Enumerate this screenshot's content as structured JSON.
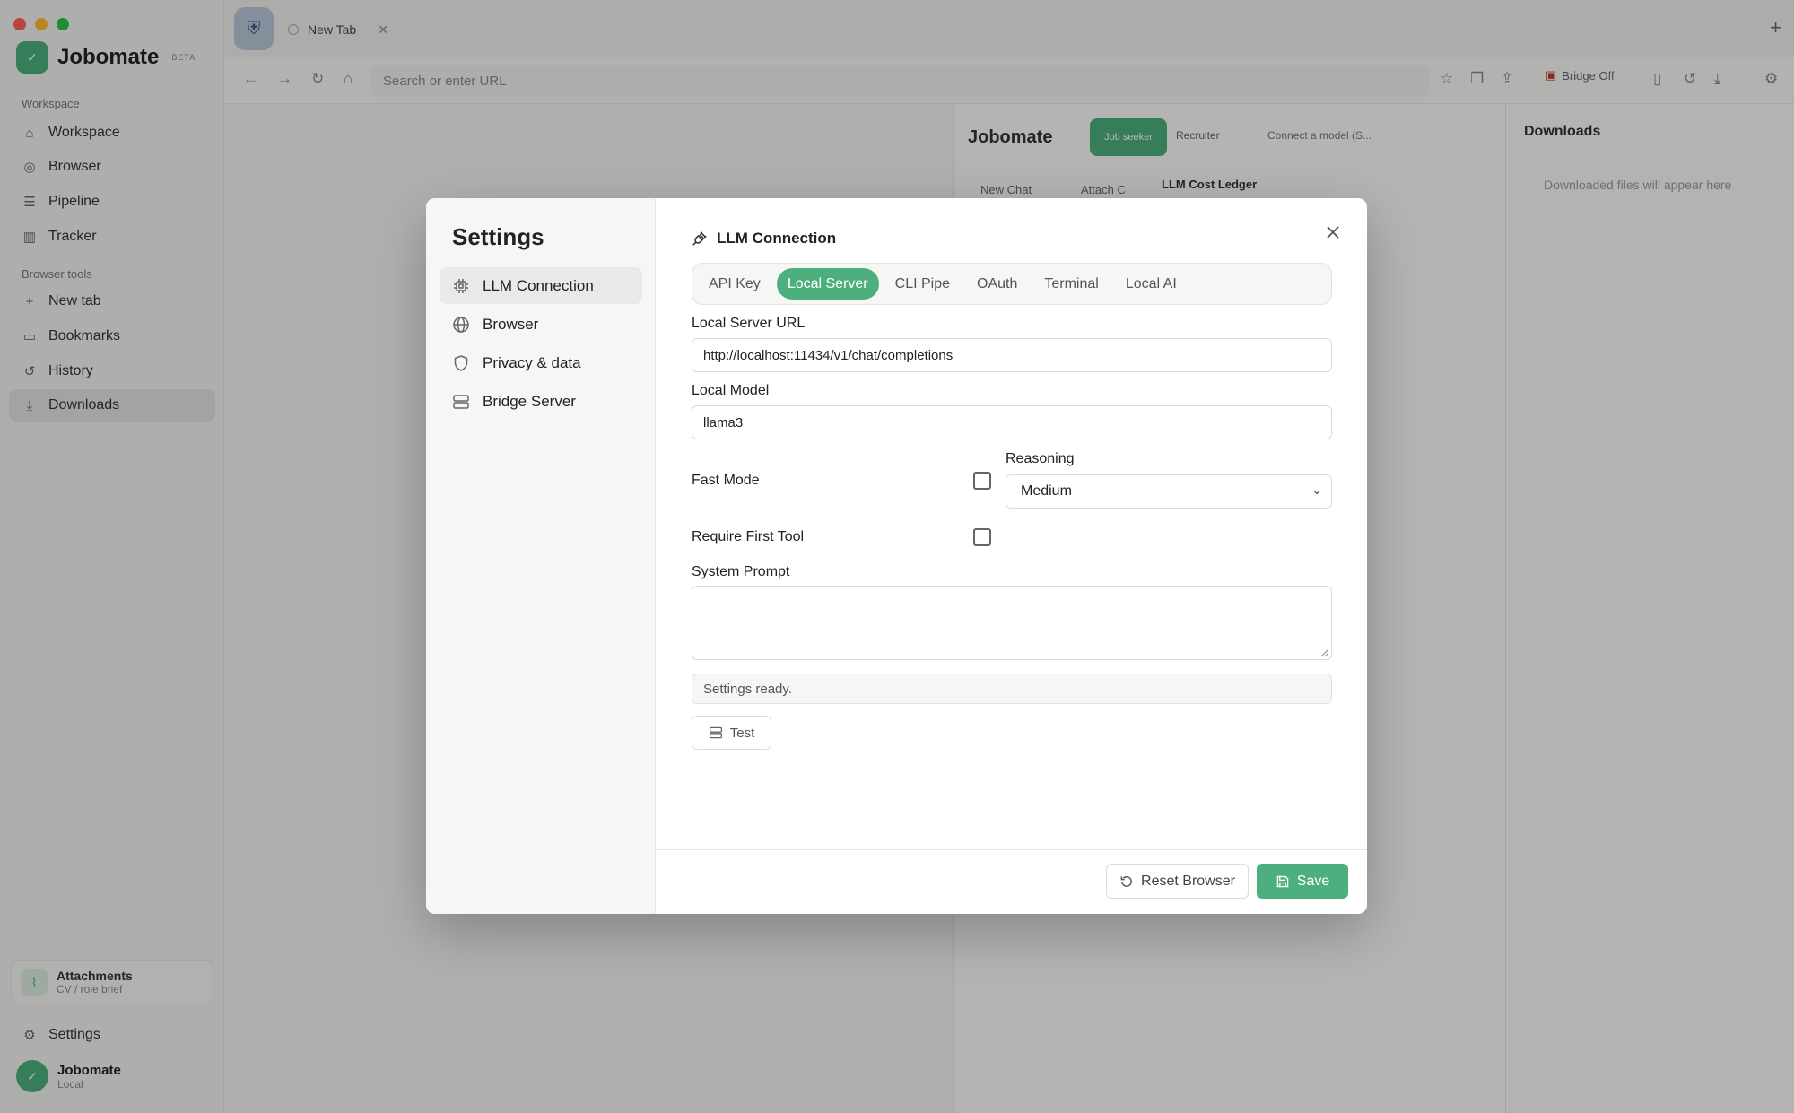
{
  "app": {
    "brand": "Jobomate",
    "brand_badge": "BETA",
    "sections": {
      "workspace": "Workspace",
      "browser_tools": "Browser tools"
    },
    "nav": [
      {
        "label": "Workspace",
        "icon": "home-icon"
      },
      {
        "label": "Browser",
        "icon": "globe-icon"
      },
      {
        "label": "Pipeline",
        "icon": "pipeline-icon"
      },
      {
        "label": "Tracker",
        "icon": "chart-icon"
      }
    ],
    "tools": [
      {
        "label": "New tab",
        "icon": "plus-icon"
      },
      {
        "label": "Bookmarks",
        "icon": "book-icon"
      },
      {
        "label": "History",
        "icon": "history-icon"
      },
      {
        "label": "Downloads",
        "icon": "download-icon"
      }
    ],
    "attachments": {
      "title": "Attachments",
      "subtitle": "CV / role brief"
    },
    "settings_label": "Settings",
    "user": {
      "name": "Jobomate",
      "subtitle": "Local"
    }
  },
  "browser": {
    "tab_title": "New Tab",
    "url_placeholder": "Search or enter URL",
    "bridge": "Bridge Off"
  },
  "chat_panel": {
    "title": "Jobomate",
    "job_seeker": "Job seeker",
    "recruiter": "Recruiter",
    "connect": "Connect a model (S...",
    "new_chat": "New Chat",
    "attach": "Attach C",
    "ledger": "LLM Cost Ledger"
  },
  "downloads": {
    "title": "Downloads",
    "empty": "Downloaded files will appear here"
  },
  "settings": {
    "title": "Settings",
    "nav": [
      {
        "label": "LLM Connection",
        "active": true
      },
      {
        "label": "Browser",
        "active": false
      },
      {
        "label": "Privacy & data",
        "active": false
      },
      {
        "label": "Bridge Server",
        "active": false
      }
    ],
    "section_title": "LLM Connection",
    "tabs": [
      {
        "label": "API Key",
        "active": false
      },
      {
        "label": "Local Server",
        "active": true
      },
      {
        "label": "CLI Pipe",
        "active": false
      },
      {
        "label": "OAuth",
        "active": false
      },
      {
        "label": "Terminal",
        "active": false
      },
      {
        "label": "Local AI",
        "active": false
      }
    ],
    "server_url_label": "Local Server URL",
    "server_url_value": "http://localhost:11434/v1/chat/completions",
    "model_label": "Local Model",
    "model_value": "llama3",
    "fast_mode_label": "Fast Mode",
    "fast_mode_checked": false,
    "reasoning_label": "Reasoning",
    "reasoning_value": "Medium",
    "require_tool_label": "Require First Tool",
    "require_tool_checked": false,
    "system_prompt_label": "System Prompt",
    "system_prompt_value": "",
    "status": "Settings ready.",
    "test_label": "Test",
    "reset_label": "Reset Browser",
    "save_label": "Save"
  },
  "colors": {
    "accent": "#4caf7d",
    "overlay": "rgba(0,0,0,0.28)"
  }
}
